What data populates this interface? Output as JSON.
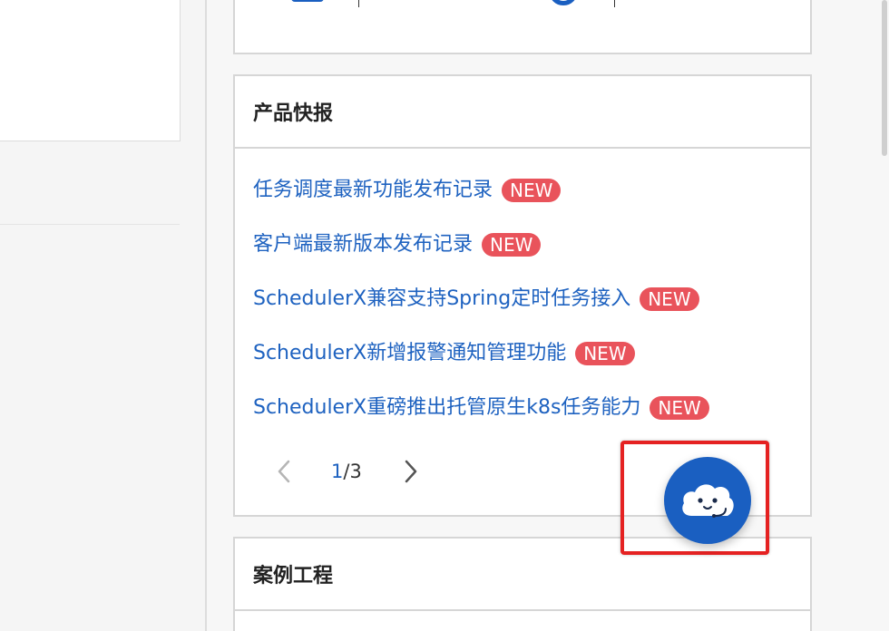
{
  "news": {
    "title": "产品快报",
    "items": [
      {
        "text": "任务调度最新功能发布记录",
        "badge": "NEW"
      },
      {
        "text": "客户端最新版本发布记录",
        "badge": "NEW"
      },
      {
        "text": "SchedulerX兼容支持Spring定时任务接入",
        "badge": "NEW"
      },
      {
        "text": "SchedulerX新增报警通知管理功能",
        "badge": "NEW"
      },
      {
        "text": "SchedulerX重磅推出托管原生k8s任务能力",
        "badge": "NEW"
      }
    ],
    "pager": {
      "current": "1",
      "total": "/3"
    }
  },
  "cases": {
    "title": "案例工程"
  },
  "icons": {
    "prev": "chevron-left-icon",
    "next": "chevron-right-icon",
    "assistant": "cloud-assistant-icon"
  },
  "colors": {
    "link": "#1e62c0",
    "badge": "#e9535b",
    "assistant": "#1a5fc1",
    "highlight": "#e52222"
  }
}
